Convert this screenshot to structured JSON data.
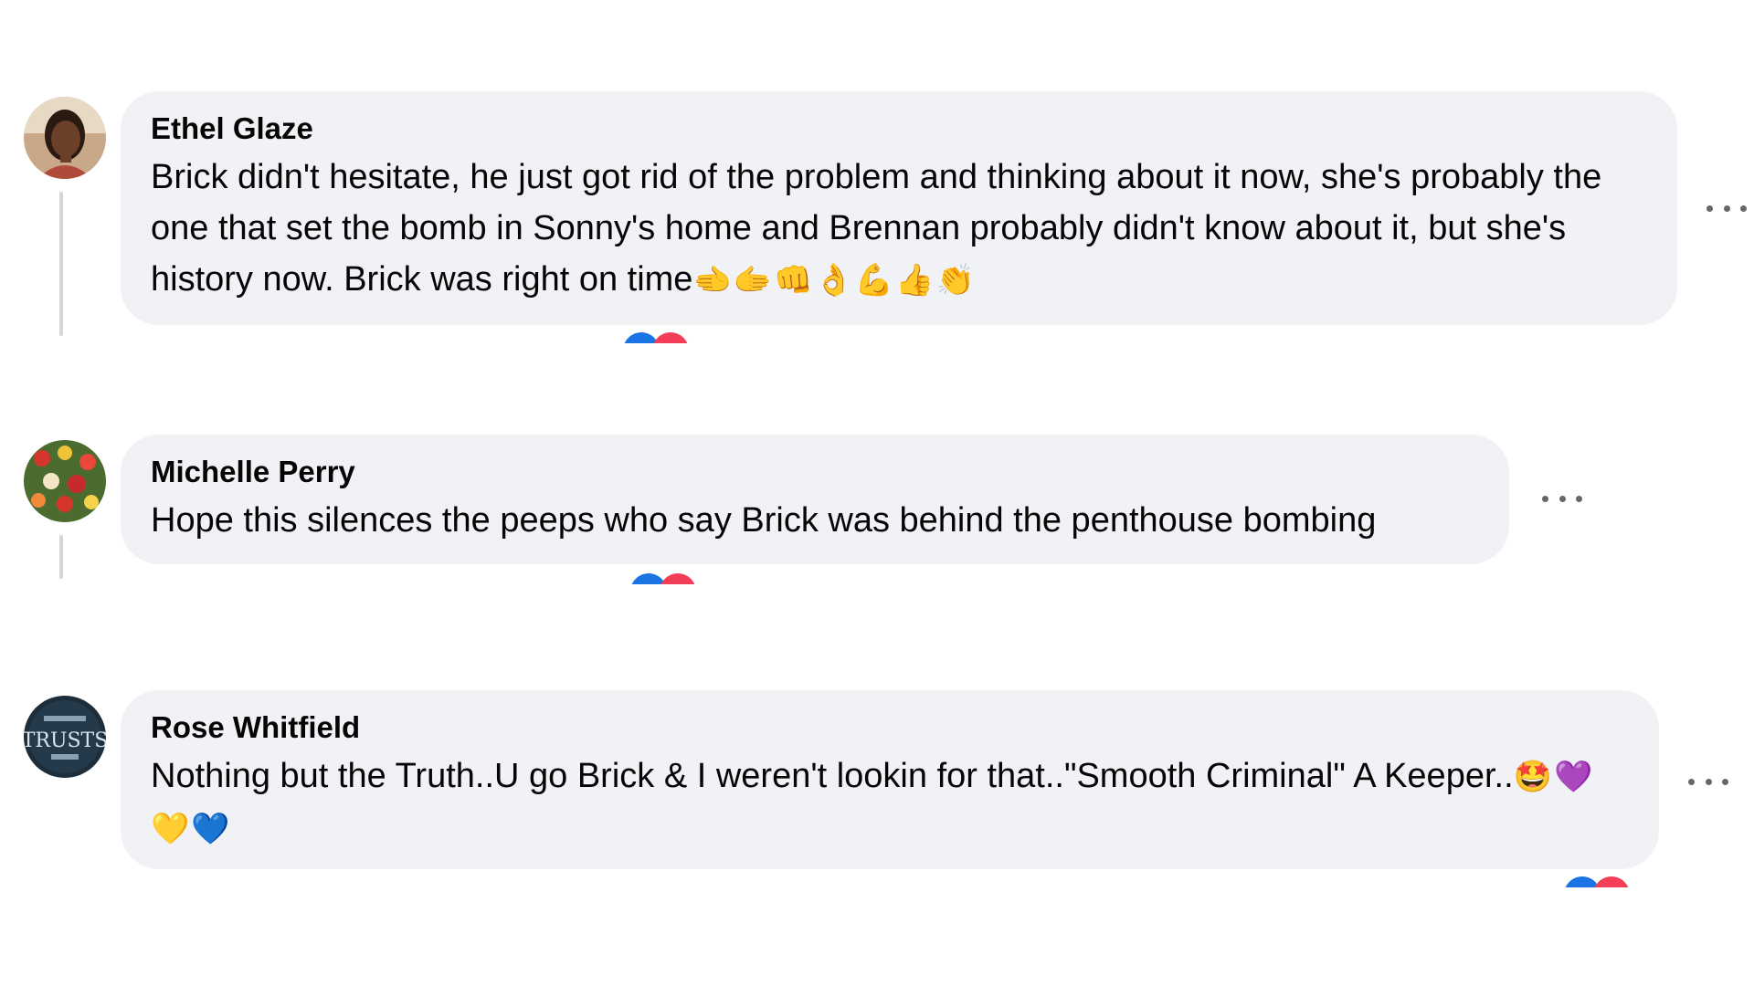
{
  "comments": [
    {
      "author": "Ethel Glaze",
      "text": "Brick didn't hesitate, he just got rid of the problem and thinking about it now, she's probably the one that set the bomb in Sonny's home and Brennan probably didn't know about it, but she's history now. Brick was right on time",
      "emojis": "🫲🫱👊👌💪👍👏",
      "avatar_icon": "person-photo-icon",
      "more_label": "More options"
    },
    {
      "author": "Michelle Perry",
      "text": "Hope this silences the peeps who say Brick was behind the penthouse bombing",
      "emojis": "",
      "avatar_icon": "flowers-photo-icon",
      "more_label": "More options"
    },
    {
      "author": "Rose Whitfield",
      "text": "Nothing but the Truth..U go Brick & I weren't lookin for that..\"Smooth Criminal\" A Keeper..",
      "emojis": "🤩💜💛💙",
      "avatar_icon": "trusts-graphic-icon",
      "more_label": "More options"
    }
  ],
  "colors": {
    "bubble": "#f0f2f5",
    "like": "#1b74e4",
    "love": "#f33e58",
    "thread": "#d3d6db"
  }
}
